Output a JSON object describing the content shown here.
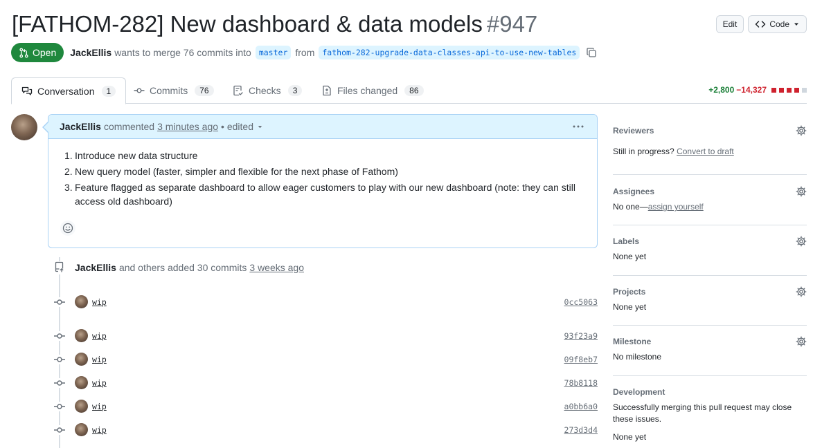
{
  "pr": {
    "title": "[FATHOM-282] New dashboard & data models",
    "number": "#947",
    "state": "Open",
    "author": "JackEllis",
    "merge_text": "wants to merge 76 commits into",
    "base_branch": "master",
    "from_text": "from",
    "head_branch": "fathom-282-upgrade-data-classes-api-to-use-new-tables"
  },
  "header_actions": {
    "edit_label": "Edit",
    "code_label": "Code"
  },
  "tabs": [
    {
      "label": "Conversation",
      "count": "1"
    },
    {
      "label": "Commits",
      "count": "76"
    },
    {
      "label": "Checks",
      "count": "3"
    },
    {
      "label": "Files changed",
      "count": "86"
    }
  ],
  "diffstat": {
    "additions": "+2,800",
    "deletions": "−14,327",
    "colors": [
      "#cf222e",
      "#cf222e",
      "#cf222e",
      "#cf222e",
      "#d0d7de"
    ]
  },
  "comment": {
    "author": "JackEllis",
    "action": "commented",
    "time": "3 minutes ago",
    "edited": "• edited",
    "items": [
      {
        "n": "1.",
        "text": "Introduce new data structure"
      },
      {
        "n": "2.",
        "text": "New query model (faster, simpler and flexible for the next phase of Fathom)"
      },
      {
        "n": "3.",
        "text": "Feature flagged as separate dashboard to allow eager customers to play with our new dashboard (note: they can still access old dashboard)"
      }
    ]
  },
  "push_event": {
    "author": "JackEllis",
    "text": "and others added 30 commits",
    "time": "3 weeks ago"
  },
  "commits": [
    {
      "message": "wip",
      "sha": "0cc5063"
    },
    {
      "message": "wip",
      "sha": "93f23a9"
    },
    {
      "message": "wip",
      "sha": "09f8eb7"
    },
    {
      "message": "wip",
      "sha": "78b8118"
    },
    {
      "message": "wip",
      "sha": "a0bb6a0"
    },
    {
      "message": "wip",
      "sha": "273d3d4"
    }
  ],
  "sidebar": {
    "reviewers": {
      "title": "Reviewers",
      "text": "Still in progress?",
      "link": "Convert to draft"
    },
    "assignees": {
      "title": "Assignees",
      "text": "No one—",
      "link": "assign yourself"
    },
    "labels": {
      "title": "Labels",
      "text": "None yet"
    },
    "projects": {
      "title": "Projects",
      "text": "None yet"
    },
    "milestone": {
      "title": "Milestone",
      "text": "No milestone"
    },
    "development": {
      "title": "Development",
      "text": "Successfully merging this pull request may close these issues.",
      "text2": "None yet"
    }
  },
  "icons": {
    "state": "git-pull-request-icon",
    "copy": "copy-icon",
    "conversation": "comment-discussion-icon",
    "commits": "git-commit-icon",
    "checks": "checklist-icon",
    "files": "file-diff-icon",
    "gear": "gear-icon",
    "more": "kebab-horizontal-icon",
    "emoji": "smiley-icon",
    "push": "repo-push-icon"
  }
}
